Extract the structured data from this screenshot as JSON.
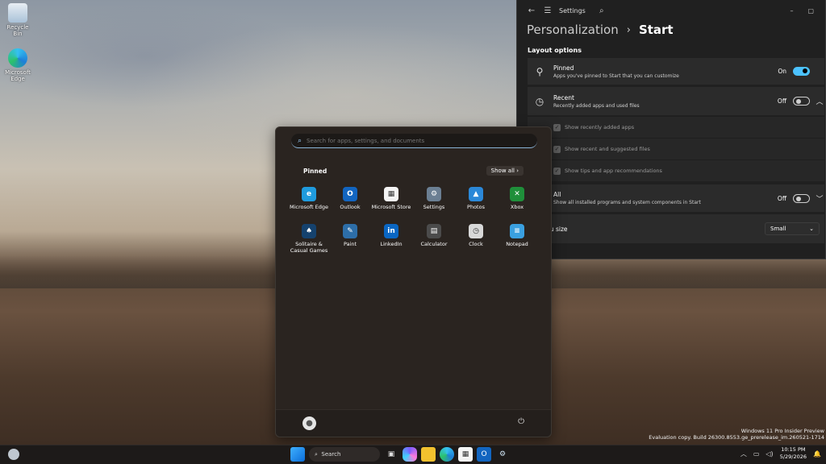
{
  "desktop": {
    "icons": [
      {
        "label": "Recycle Bin",
        "icon": "recycle-bin-icon"
      },
      {
        "label": "Microsoft Edge",
        "icon": "edge-icon"
      }
    ],
    "watermark": {
      "line1": "Windows 11 Pro Insider Preview",
      "line2": "Evaluation copy. Build 26300.8553.ge_prerelease_im.260521-1714"
    }
  },
  "settings": {
    "window_title": "Settings",
    "breadcrumb": {
      "parent": "Personalization",
      "separator": "›",
      "current": "Start"
    },
    "section_title": "Layout options",
    "pinned": {
      "title": "Pinned",
      "desc": "Apps you've pinned to Start that you can customize",
      "state": "On",
      "checked": true
    },
    "recent": {
      "title": "Recent",
      "desc": "Recently added apps and used files",
      "state": "Off",
      "checked": false
    },
    "recent_options": [
      {
        "label": "Show recently added apps"
      },
      {
        "label": "Show recent and suggested files"
      },
      {
        "label": "Show tips and app recommendations"
      }
    ],
    "all": {
      "title": "All",
      "desc": "Show all installed programs and system components in Start",
      "state": "Off",
      "checked": false
    },
    "menu_size": {
      "label": "Menu size",
      "value": "Small"
    }
  },
  "start_menu": {
    "search_placeholder": "Search for apps, settings, and documents",
    "pinned_label": "Pinned",
    "show_all_label": "Show all",
    "apps": [
      {
        "label": "Microsoft Edge",
        "color": "#1f9bde",
        "glyph": "e"
      },
      {
        "label": "Outlook",
        "color": "#1265c0",
        "glyph": "O"
      },
      {
        "label": "Microsoft Store",
        "color": "#f4f4f4",
        "glyph": "▦"
      },
      {
        "label": "Settings",
        "color": "#6b7f93",
        "glyph": "⚙"
      },
      {
        "label": "Photos",
        "color": "#2b88d8",
        "glyph": "▲"
      },
      {
        "label": "Xbox",
        "color": "#1f8f3a",
        "glyph": "✕"
      },
      {
        "label": "Solitaire &\nCasual Games",
        "color": "#15426e",
        "glyph": "♠"
      },
      {
        "label": "Paint",
        "color": "#2d6ea8",
        "glyph": "✎"
      },
      {
        "label": "LinkedIn",
        "color": "#0a66c2",
        "glyph": "in"
      },
      {
        "label": "Calculator",
        "color": "#4b4b4b",
        "glyph": "▤"
      },
      {
        "label": "Clock",
        "color": "#d8d8d8",
        "glyph": "◷"
      },
      {
        "label": "Notepad",
        "color": "#3aa0e0",
        "glyph": "≡"
      }
    ]
  },
  "taskbar": {
    "search_label": "Search",
    "time": "10:15 PM",
    "date": "5/29/2026"
  }
}
